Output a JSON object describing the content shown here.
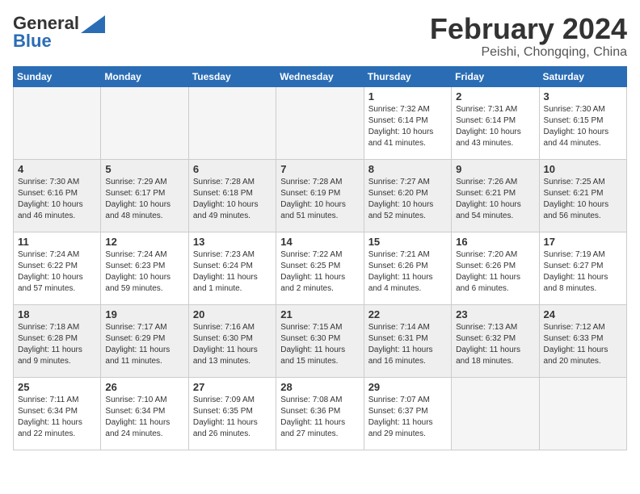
{
  "header": {
    "logo_general": "General",
    "logo_blue": "Blue",
    "month_year": "February 2024",
    "location": "Peishi, Chongqing, China"
  },
  "days_of_week": [
    "Sunday",
    "Monday",
    "Tuesday",
    "Wednesday",
    "Thursday",
    "Friday",
    "Saturday"
  ],
  "weeks": [
    [
      {
        "day": "",
        "info": "",
        "empty": true
      },
      {
        "day": "",
        "info": "",
        "empty": true
      },
      {
        "day": "",
        "info": "",
        "empty": true
      },
      {
        "day": "",
        "info": "",
        "empty": true
      },
      {
        "day": "1",
        "info": "Sunrise: 7:32 AM\nSunset: 6:14 PM\nDaylight: 10 hours\nand 41 minutes.",
        "empty": false
      },
      {
        "day": "2",
        "info": "Sunrise: 7:31 AM\nSunset: 6:14 PM\nDaylight: 10 hours\nand 43 minutes.",
        "empty": false
      },
      {
        "day": "3",
        "info": "Sunrise: 7:30 AM\nSunset: 6:15 PM\nDaylight: 10 hours\nand 44 minutes.",
        "empty": false
      }
    ],
    [
      {
        "day": "4",
        "info": "Sunrise: 7:30 AM\nSunset: 6:16 PM\nDaylight: 10 hours\nand 46 minutes.",
        "empty": false
      },
      {
        "day": "5",
        "info": "Sunrise: 7:29 AM\nSunset: 6:17 PM\nDaylight: 10 hours\nand 48 minutes.",
        "empty": false
      },
      {
        "day": "6",
        "info": "Sunrise: 7:28 AM\nSunset: 6:18 PM\nDaylight: 10 hours\nand 49 minutes.",
        "empty": false
      },
      {
        "day": "7",
        "info": "Sunrise: 7:28 AM\nSunset: 6:19 PM\nDaylight: 10 hours\nand 51 minutes.",
        "empty": false
      },
      {
        "day": "8",
        "info": "Sunrise: 7:27 AM\nSunset: 6:20 PM\nDaylight: 10 hours\nand 52 minutes.",
        "empty": false
      },
      {
        "day": "9",
        "info": "Sunrise: 7:26 AM\nSunset: 6:21 PM\nDaylight: 10 hours\nand 54 minutes.",
        "empty": false
      },
      {
        "day": "10",
        "info": "Sunrise: 7:25 AM\nSunset: 6:21 PM\nDaylight: 10 hours\nand 56 minutes.",
        "empty": false
      }
    ],
    [
      {
        "day": "11",
        "info": "Sunrise: 7:24 AM\nSunset: 6:22 PM\nDaylight: 10 hours\nand 57 minutes.",
        "empty": false
      },
      {
        "day": "12",
        "info": "Sunrise: 7:24 AM\nSunset: 6:23 PM\nDaylight: 10 hours\nand 59 minutes.",
        "empty": false
      },
      {
        "day": "13",
        "info": "Sunrise: 7:23 AM\nSunset: 6:24 PM\nDaylight: 11 hours\nand 1 minute.",
        "empty": false
      },
      {
        "day": "14",
        "info": "Sunrise: 7:22 AM\nSunset: 6:25 PM\nDaylight: 11 hours\nand 2 minutes.",
        "empty": false
      },
      {
        "day": "15",
        "info": "Sunrise: 7:21 AM\nSunset: 6:26 PM\nDaylight: 11 hours\nand 4 minutes.",
        "empty": false
      },
      {
        "day": "16",
        "info": "Sunrise: 7:20 AM\nSunset: 6:26 PM\nDaylight: 11 hours\nand 6 minutes.",
        "empty": false
      },
      {
        "day": "17",
        "info": "Sunrise: 7:19 AM\nSunset: 6:27 PM\nDaylight: 11 hours\nand 8 minutes.",
        "empty": false
      }
    ],
    [
      {
        "day": "18",
        "info": "Sunrise: 7:18 AM\nSunset: 6:28 PM\nDaylight: 11 hours\nand 9 minutes.",
        "empty": false
      },
      {
        "day": "19",
        "info": "Sunrise: 7:17 AM\nSunset: 6:29 PM\nDaylight: 11 hours\nand 11 minutes.",
        "empty": false
      },
      {
        "day": "20",
        "info": "Sunrise: 7:16 AM\nSunset: 6:30 PM\nDaylight: 11 hours\nand 13 minutes.",
        "empty": false
      },
      {
        "day": "21",
        "info": "Sunrise: 7:15 AM\nSunset: 6:30 PM\nDaylight: 11 hours\nand 15 minutes.",
        "empty": false
      },
      {
        "day": "22",
        "info": "Sunrise: 7:14 AM\nSunset: 6:31 PM\nDaylight: 11 hours\nand 16 minutes.",
        "empty": false
      },
      {
        "day": "23",
        "info": "Sunrise: 7:13 AM\nSunset: 6:32 PM\nDaylight: 11 hours\nand 18 minutes.",
        "empty": false
      },
      {
        "day": "24",
        "info": "Sunrise: 7:12 AM\nSunset: 6:33 PM\nDaylight: 11 hours\nand 20 minutes.",
        "empty": false
      }
    ],
    [
      {
        "day": "25",
        "info": "Sunrise: 7:11 AM\nSunset: 6:34 PM\nDaylight: 11 hours\nand 22 minutes.",
        "empty": false
      },
      {
        "day": "26",
        "info": "Sunrise: 7:10 AM\nSunset: 6:34 PM\nDaylight: 11 hours\nand 24 minutes.",
        "empty": false
      },
      {
        "day": "27",
        "info": "Sunrise: 7:09 AM\nSunset: 6:35 PM\nDaylight: 11 hours\nand 26 minutes.",
        "empty": false
      },
      {
        "day": "28",
        "info": "Sunrise: 7:08 AM\nSunset: 6:36 PM\nDaylight: 11 hours\nand 27 minutes.",
        "empty": false
      },
      {
        "day": "29",
        "info": "Sunrise: 7:07 AM\nSunset: 6:37 PM\nDaylight: 11 hours\nand 29 minutes.",
        "empty": false
      },
      {
        "day": "",
        "info": "",
        "empty": true
      },
      {
        "day": "",
        "info": "",
        "empty": true
      }
    ]
  ]
}
